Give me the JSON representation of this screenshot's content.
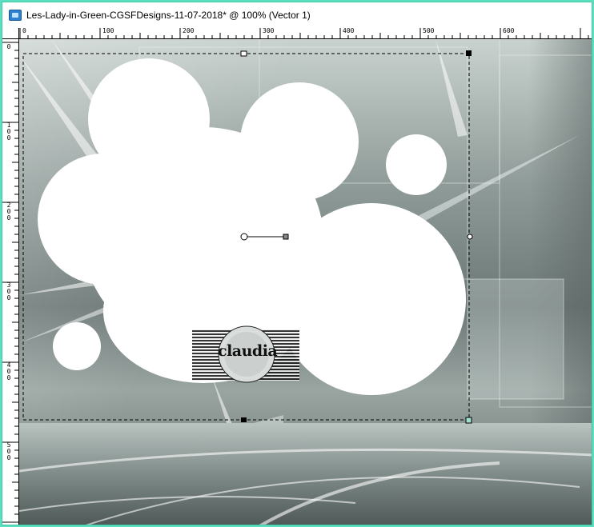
{
  "window": {
    "title": "Les-Lady-in-Green-CGSFDesigns-11-07-2018* @ 100% (Vector 1)",
    "icon": "psp-document-icon"
  },
  "ruler": {
    "top_labels": [
      "0",
      "100",
      "200",
      "300",
      "400",
      "500",
      "600"
    ],
    "left_labels": [
      "0",
      "100",
      "200",
      "300",
      "400",
      "500"
    ]
  },
  "watermark": {
    "text": "claudia"
  },
  "colors": {
    "accent_border": "#3cc9a4",
    "shape_fill": "#ffffff",
    "selection_line": "#000000"
  }
}
